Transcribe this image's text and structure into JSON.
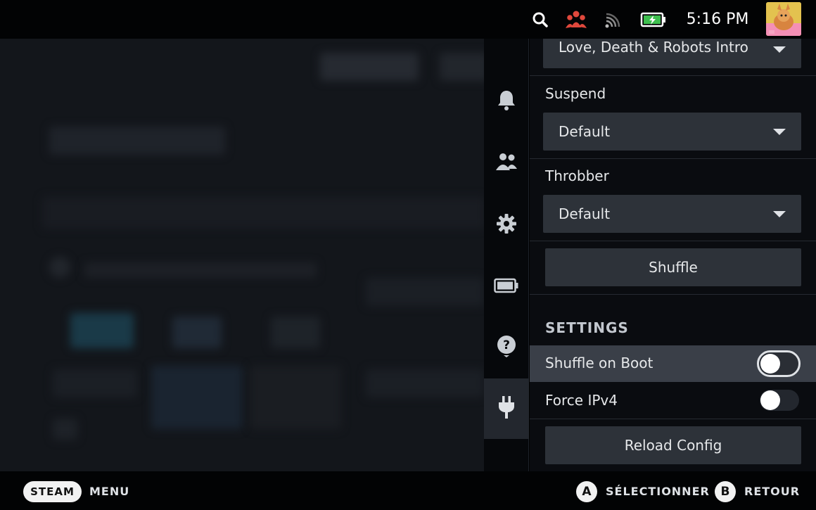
{
  "status_bar": {
    "time": "5:16 PM",
    "icons": [
      "search-icon",
      "friends-icon",
      "wifi-icon",
      "battery-charging-icon"
    ],
    "accent_color": "#e0483c"
  },
  "side_nav": {
    "items": [
      {
        "icon": "bell-icon"
      },
      {
        "icon": "friends-icon"
      },
      {
        "icon": "gear-icon"
      },
      {
        "icon": "battery-icon"
      },
      {
        "icon": "help-icon"
      },
      {
        "icon": "plug-icon",
        "active": true
      }
    ]
  },
  "panel": {
    "top_dropdown": {
      "value": "Love, Death & Robots Intro"
    },
    "suspend": {
      "label": "Suspend",
      "value": "Default"
    },
    "throbber": {
      "label": "Throbber",
      "value": "Default"
    },
    "shuffle_button": "Shuffle",
    "settings_heading": "SETTINGS",
    "shuffle_on_boot": {
      "label": "Shuffle on Boot",
      "enabled": false
    },
    "force_ipv4": {
      "label": "Force IPv4",
      "enabled": false
    },
    "reload_button": "Reload Config"
  },
  "bottom_bar": {
    "steam_label": "STEAM",
    "menu_label": "MENU",
    "a_glyph": "A",
    "a_label": "SÉLECTIONNER",
    "b_glyph": "B",
    "b_label": "RETOUR"
  }
}
